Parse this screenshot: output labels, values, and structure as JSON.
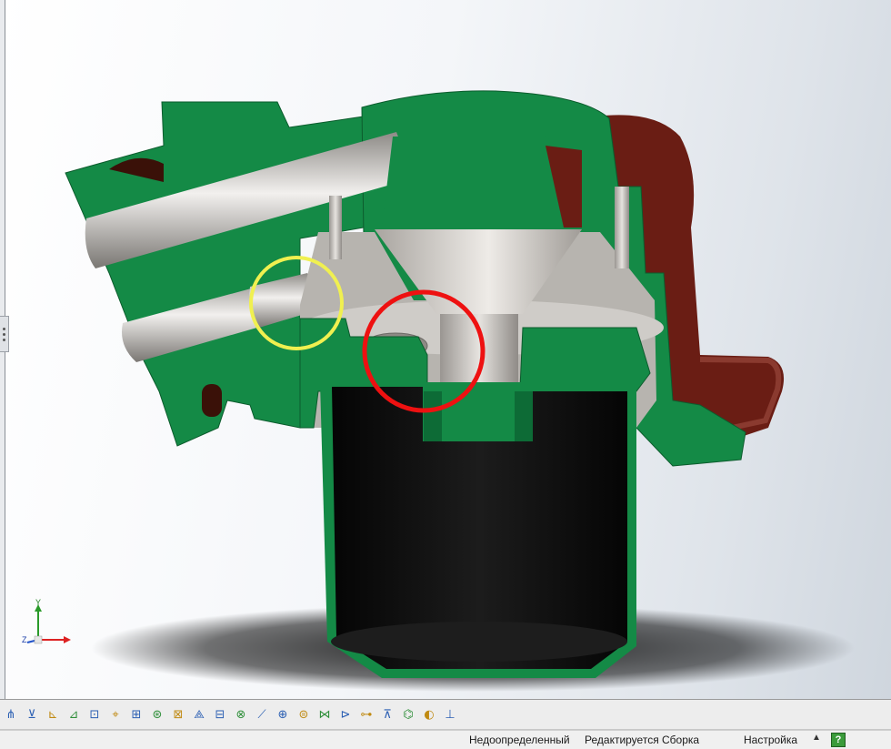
{
  "viewport": {
    "background_colors": [
      "#ffffff",
      "#cfd6de"
    ],
    "section_color": "#148a46",
    "body_color": "#6a1d14",
    "metal_color": "#c9c6c2",
    "filter_color": "#0a0a0a",
    "highlight_yellow": "#f0f050",
    "highlight_red": "#ee1111"
  },
  "triad": {
    "y_label": "Y",
    "z_label": "Z"
  },
  "toolbar": {
    "buttons": [
      {
        "name": "mate-tool-1-button",
        "icon": "⋔"
      },
      {
        "name": "mate-tool-2-button",
        "icon": "⊻"
      },
      {
        "name": "mate-tool-3-button",
        "icon": "⊾"
      },
      {
        "name": "sketch-tool-button",
        "icon": "⊿"
      },
      {
        "name": "mate-tool-5-button",
        "icon": "⊡"
      },
      {
        "name": "mate-tool-6-button",
        "icon": "⌖"
      },
      {
        "name": "mate-tool-7-button",
        "icon": "⊞"
      },
      {
        "name": "mate-tool-8-button",
        "icon": "⊛"
      },
      {
        "name": "mate-tool-9-button",
        "icon": "⊠"
      },
      {
        "name": "mate-tool-10-button",
        "icon": "⟁"
      },
      {
        "name": "mate-tool-11-button",
        "icon": "⊟"
      },
      {
        "name": "mate-tool-12-button",
        "icon": "⊗"
      },
      {
        "name": "mate-tool-13-button",
        "icon": "⟋"
      },
      {
        "name": "mate-tool-14-button",
        "icon": "⊕"
      },
      {
        "name": "mate-tool-15-button",
        "icon": "⊜"
      },
      {
        "name": "mate-tool-16-button",
        "icon": "⋈"
      },
      {
        "name": "mate-tool-17-button",
        "icon": "⊳"
      },
      {
        "name": "mate-tool-18-button",
        "icon": "⊶"
      },
      {
        "name": "mate-tool-19-button",
        "icon": "⊼"
      },
      {
        "name": "mate-tool-20-button",
        "icon": "⌬"
      },
      {
        "name": "mate-tool-21-button",
        "icon": "◐"
      },
      {
        "name": "mate-tool-22-button",
        "icon": "⊥"
      }
    ]
  },
  "status": {
    "definition_state": "Недоопределенный",
    "edit_state": "Редактируется Сборка",
    "settings": "Настройка",
    "help_icon_label": "?"
  }
}
